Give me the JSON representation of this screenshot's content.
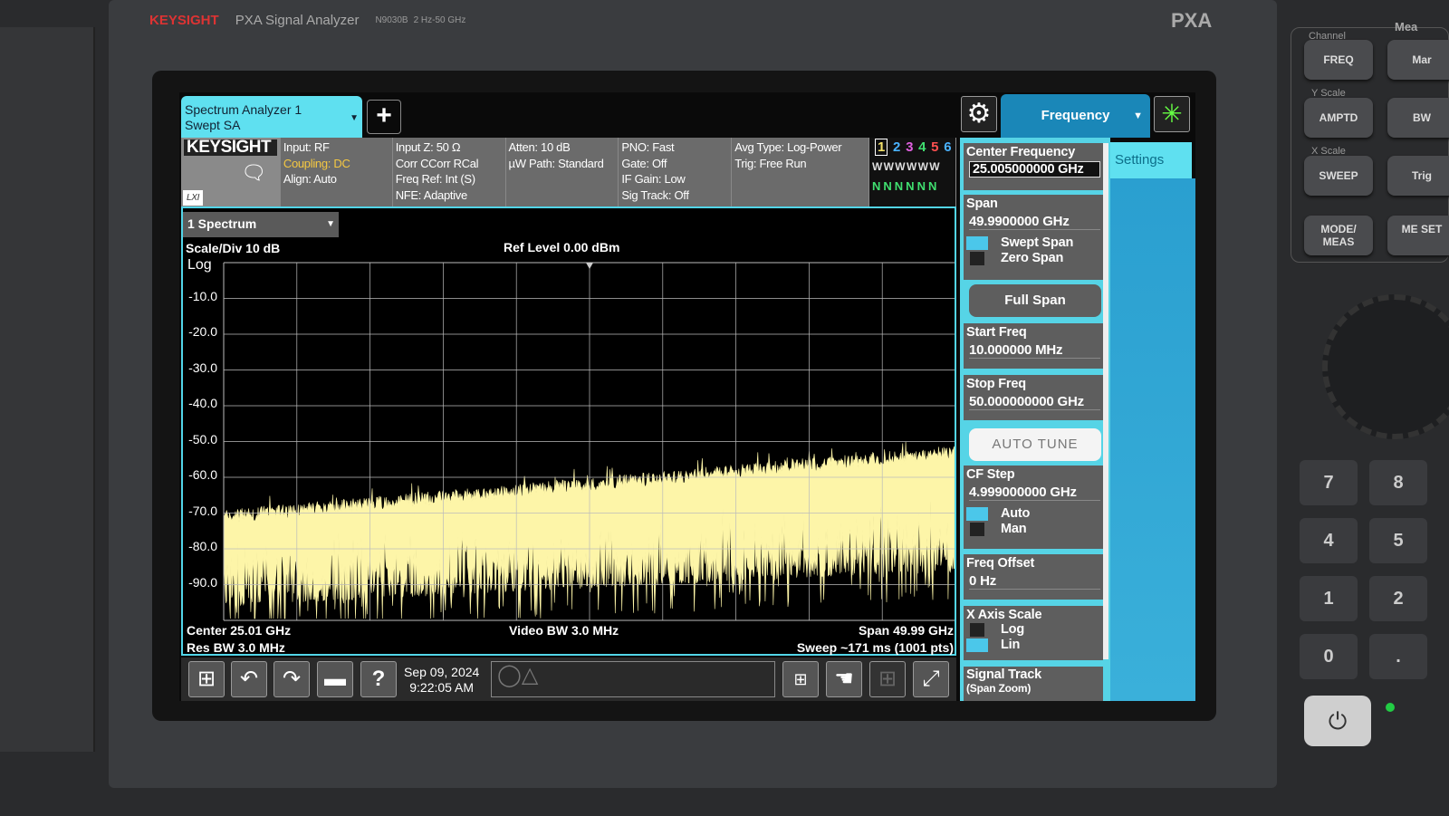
{
  "instrument": {
    "brand": "KEYSIGHT",
    "model": "PXA Signal Analyzer",
    "model_no": "N9030B",
    "range": "2 Hz-50 GHz",
    "badge": "PXA"
  },
  "hardware": {
    "channel": "Channel",
    "freq": "FREQ",
    "mar": "Mar",
    "yscale": "Y Scale",
    "amptd": "AMPTD",
    "bw": "BW",
    "xscale": "X Scale",
    "sweep": "SWEEP",
    "trig": "Trig",
    "mode": "MODE/ MEAS",
    "mset": "ME SET",
    "meas": "Mea",
    "keys": [
      "7",
      "8",
      "4",
      "5",
      "1",
      "2",
      "0",
      "."
    ]
  },
  "tab": {
    "line1": "Spectrum Analyzer 1",
    "line2": "Swept SA",
    "add": "+"
  },
  "info": {
    "logo": "KEYSIGHT",
    "lxi": "LXI",
    "col1": [
      "Input: RF",
      "Coupling: DC",
      "Align: Auto"
    ],
    "col2": [
      "Input Z: 50 Ω",
      "Corr CCorr RCal",
      "Freq Ref: Int (S)",
      "NFE: Adaptive"
    ],
    "col3": [
      "Atten: 10 dB",
      "µW Path: Standard"
    ],
    "col4": [
      "PNO: Fast",
      "Gate: Off",
      "IF Gain: Low",
      "Sig Track: Off"
    ],
    "col5": [
      "Avg Type: Log-Power",
      "Trig: Free Run"
    ],
    "traces": [
      "1",
      "2",
      "3",
      "4",
      "5",
      "6"
    ],
    "trace_colors": [
      "#f5e36a",
      "#4ab3ff",
      "#e060e0",
      "#40e070",
      "#ff5050",
      "#4ab3ff"
    ],
    "types": "W W W W W W",
    "detectors": "N N N N N N"
  },
  "window": {
    "select": "1 Spectrum"
  },
  "chart_data": {
    "type": "line",
    "scale_div": "Scale/Div 10 dB",
    "ref_level": "Ref Level 0.00 dBm",
    "scale": "Log",
    "yticks": [
      "-10.0",
      "-20.0",
      "-30.0",
      "-40.0",
      "-50.0",
      "-60.0",
      "-70.0",
      "-80.0",
      "-90.0"
    ],
    "ylim": [
      -100,
      0
    ],
    "xlim_ghz": [
      0.01,
      50
    ],
    "center": "Center 25.01 GHz",
    "res_bw": "Res BW 3.0 MHz",
    "video_bw": "Video BW 3.0 MHz",
    "span": "Span 49.99 GHz",
    "sweep": "Sweep ~171 ms (1001 pts)",
    "trace_color": "#fdf5a8",
    "grid": true
  },
  "taskbar": {
    "date": "Sep 09, 2024",
    "time": "9:22:05 AM"
  },
  "menu": {
    "title": "Frequency",
    "settings": "Settings",
    "center_label": "Center Frequency",
    "center_value": "25.005000000 GHz",
    "span_label": "Span",
    "span_value": "49.9900000 GHz",
    "swept": "Swept Span",
    "zero": "Zero Span",
    "full_span": "Full Span",
    "start_label": "Start Freq",
    "start_value": "10.000000 MHz",
    "stop_label": "Stop Freq",
    "stop_value": "50.000000000 GHz",
    "auto_tune": "AUTO TUNE",
    "cf_label": "CF Step",
    "cf_value": "4.999000000 GHz",
    "auto": "Auto",
    "man": "Man",
    "offset_label": "Freq Offset",
    "offset_value": "0 Hz",
    "xaxis_label": "X Axis Scale",
    "log": "Log",
    "lin": "Lin",
    "sigtrack_label": "Signal Track",
    "sigtrack_sub": "(Span Zoom)"
  }
}
